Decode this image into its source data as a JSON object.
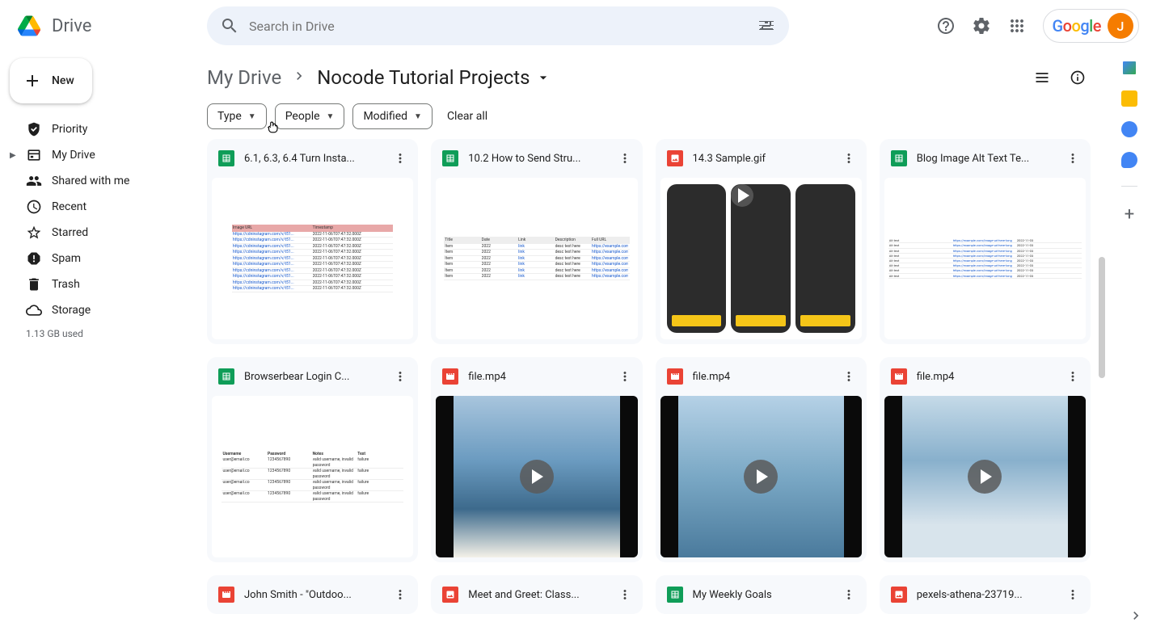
{
  "app": {
    "name": "Drive"
  },
  "search": {
    "placeholder": "Search in Drive"
  },
  "account": {
    "initial": "J"
  },
  "newButton": "New",
  "sidebar": {
    "items": [
      {
        "label": "Priority"
      },
      {
        "label": "My Drive"
      },
      {
        "label": "Shared with me"
      },
      {
        "label": "Recent"
      },
      {
        "label": "Starred"
      },
      {
        "label": "Spam"
      },
      {
        "label": "Trash"
      },
      {
        "label": "Storage"
      }
    ],
    "storageUsed": "1.13 GB used"
  },
  "breadcrumb": {
    "parent": "My Drive",
    "current": "Nocode Tutorial Projects"
  },
  "filters": {
    "type": "Type",
    "people": "People",
    "modified": "Modified",
    "clearAll": "Clear all"
  },
  "files": [
    {
      "name": "6.1, 6.3, 6.4 Turn Insta...",
      "type": "sheets",
      "thumb": "sheet-pink"
    },
    {
      "name": "10.2 How to Send Stru...",
      "type": "sheets",
      "thumb": "sheet-links"
    },
    {
      "name": "14.3 Sample.gif",
      "type": "image",
      "thumb": "phones"
    },
    {
      "name": "Blog Image Alt Text Te...",
      "type": "sheets",
      "thumb": "sheet-wide"
    },
    {
      "name": "Browserbear Login C...",
      "type": "sheets",
      "thumb": "sheet-login"
    },
    {
      "name": "file.mp4",
      "type": "video",
      "thumb": "surf1"
    },
    {
      "name": "file.mp4",
      "type": "video",
      "thumb": "surf2"
    },
    {
      "name": "file.mp4",
      "type": "video",
      "thumb": "surf3"
    },
    {
      "name": "John Smith - \"Outdoo...",
      "type": "video",
      "thumb": "none"
    },
    {
      "name": "Meet and Greet: Class...",
      "type": "image",
      "thumb": "none"
    },
    {
      "name": "My Weekly Goals",
      "type": "sheets",
      "thumb": "none"
    },
    {
      "name": "pexels-athena-23719...",
      "type": "image",
      "thumb": "none"
    }
  ],
  "sidePanel": {
    "apps": [
      "calendar",
      "keep",
      "tasks",
      "contacts"
    ]
  }
}
